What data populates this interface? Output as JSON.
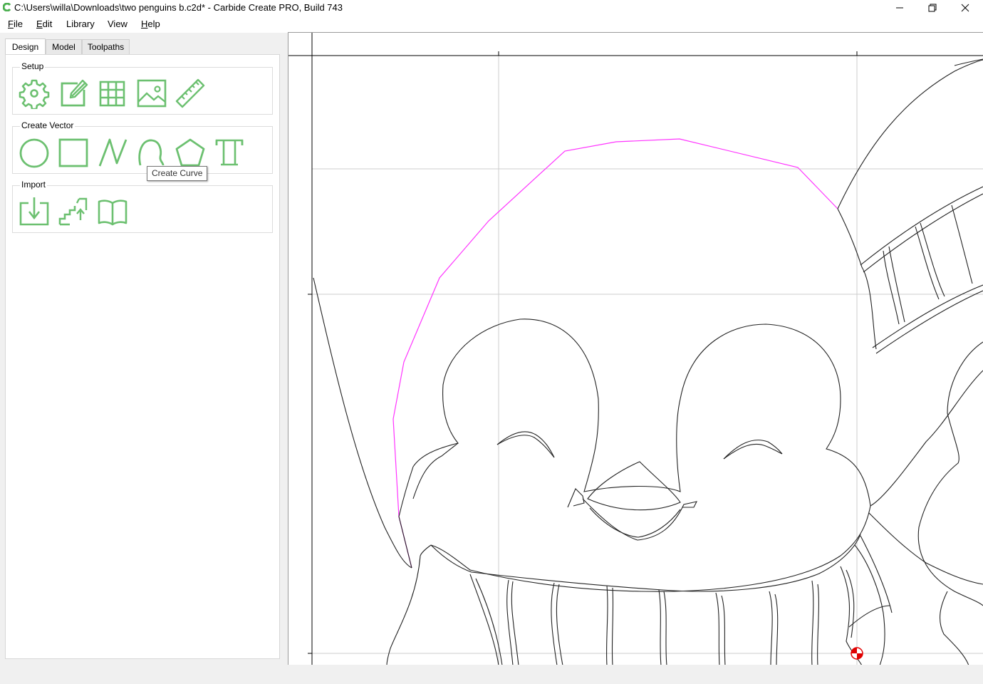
{
  "window": {
    "title": "C:\\Users\\willa\\Downloads\\two penguins b.c2d* - Carbide Create PRO, Build 743"
  },
  "menubar": {
    "items": [
      {
        "label": "File",
        "key": "F",
        "rest": "ile"
      },
      {
        "label": "Edit",
        "key": "E",
        "rest": "dit"
      },
      {
        "label": "Library",
        "key": "",
        "rest": "Library"
      },
      {
        "label": "View",
        "key": "",
        "rest": "View"
      },
      {
        "label": "Help",
        "key": "H",
        "rest": "elp"
      }
    ]
  },
  "tabs": [
    "Design",
    "Model",
    "Toolpaths"
  ],
  "active_tab": "Design",
  "groups": {
    "setup": {
      "label": "Setup",
      "tools": [
        "gear-icon",
        "edit-job-icon",
        "grid-icon",
        "image-icon",
        "ruler-icon"
      ]
    },
    "create_vector": {
      "label": "Create Vector",
      "tools": [
        "circle-icon",
        "rectangle-icon",
        "polyline-icon",
        "curve-icon",
        "polygon-icon",
        "text-icon"
      ]
    },
    "import": {
      "label": "Import",
      "tools": [
        "import-icon",
        "stairs-icon",
        "book-icon"
      ]
    }
  },
  "tooltip": {
    "text": "Create Curve"
  },
  "colors": {
    "accent": "#6cc070",
    "selection": "#ff33ff",
    "vector": "#000000",
    "origin_red": "#e00000"
  }
}
